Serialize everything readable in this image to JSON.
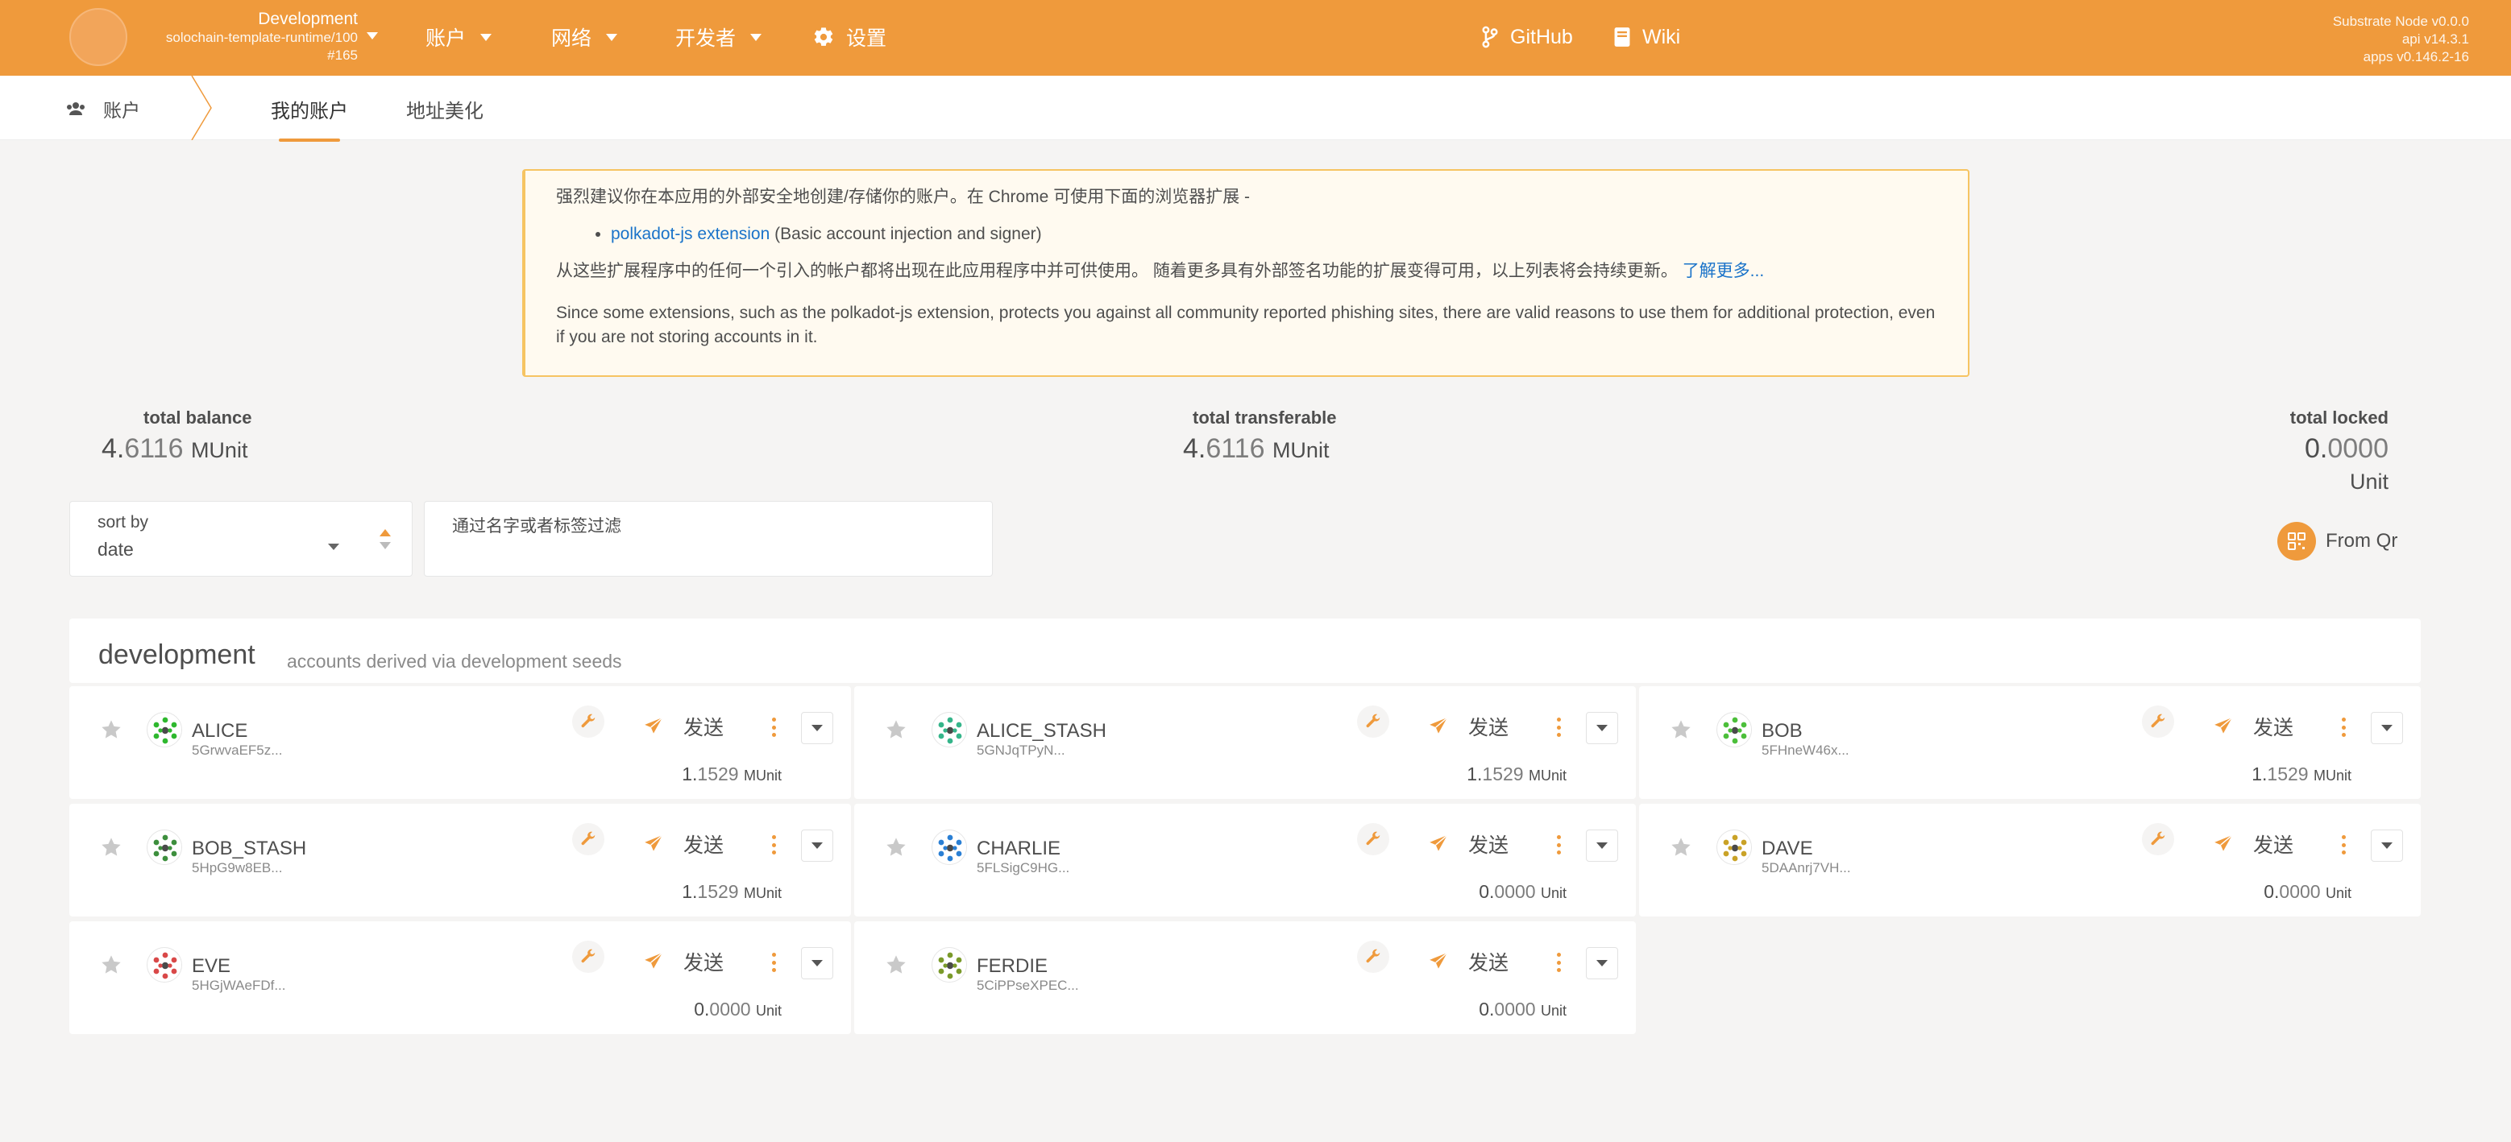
{
  "chain": {
    "name": "Development",
    "runtime": "solochain-template-runtime/100",
    "block": "#165"
  },
  "menu": {
    "accounts": "账户",
    "network": "网络",
    "developer": "开发者",
    "settings": "设置",
    "github": "GitHub",
    "wiki": "Wiki"
  },
  "node_info": {
    "node": "Substrate Node v0.0.0",
    "api": "api v14.3.1",
    "apps": "apps v0.146.2-16"
  },
  "subnav": {
    "section": "账户",
    "tabs": [
      "我的账户",
      "地址美化"
    ]
  },
  "warning": {
    "line1": "强烈建议你在本应用的外部安全地创建/存储你的账户。在 Chrome 可使用下面的浏览器扩展 -",
    "ext_link": "polkadot-js extension",
    "ext_desc": "(Basic account injection and signer)",
    "line2": "从这些扩展程序中的任何一个引入的帐户都将出现在此应用程序中并可供使用。 随着更多具有外部签名功能的扩展变得可用，以上列表将会持续更新。",
    "learn_more": "了解更多...",
    "line3": "Since some extensions, such as the polkadot-js extension, protects you against all community reported phishing sites, there are valid reasons to use them for additional protection, even if you are not storing accounts in it."
  },
  "summary": {
    "total_balance": {
      "label": "total balance",
      "int": "4.",
      "dec": "6116",
      "unit": "MUnit"
    },
    "total_transferable": {
      "label": "total transferable",
      "int": "4.",
      "dec": "6116",
      "unit": "MUnit"
    },
    "total_locked": {
      "label": "total locked",
      "int": "0.",
      "dec": "0000",
      "unit": "Unit"
    }
  },
  "filters": {
    "sort_label": "sort by",
    "sort_value": "date",
    "filter_label": "通过名字或者标签过滤",
    "from_qr": "From Qr"
  },
  "group": {
    "title": "development",
    "subtitle": "accounts derived via development seeds"
  },
  "send_label": "发送",
  "accounts": [
    {
      "name": "ALICE",
      "address": "5GrwvaEF5z...",
      "bal_int": "1.",
      "bal_dec": "1529",
      "unit": "MUnit",
      "color": "#2eb82e"
    },
    {
      "name": "ALICE_STASH",
      "address": "5GNJqTPyN...",
      "bal_int": "1.",
      "bal_dec": "1529",
      "unit": "MUnit",
      "color": "#35b58a"
    },
    {
      "name": "BOB",
      "address": "5FHneW46x...",
      "bal_int": "1.",
      "bal_dec": "1529",
      "unit": "MUnit",
      "color": "#4cbf3a"
    },
    {
      "name": "BOB_STASH",
      "address": "5HpG9w8EB...",
      "bal_int": "1.",
      "bal_dec": "1529",
      "unit": "MUnit",
      "color": "#3d8f3d"
    },
    {
      "name": "CHARLIE",
      "address": "5FLSigC9HG...",
      "bal_int": "0.",
      "bal_dec": "0000",
      "unit": "Unit",
      "color": "#2a7fd4"
    },
    {
      "name": "DAVE",
      "address": "5DAAnrj7VH...",
      "bal_int": "0.",
      "bal_dec": "0000",
      "unit": "Unit",
      "color": "#c9a227"
    },
    {
      "name": "EVE",
      "address": "5HGjWAeFDf...",
      "bal_int": "0.",
      "bal_dec": "0000",
      "unit": "Unit",
      "color": "#d94848"
    },
    {
      "name": "FERDIE",
      "address": "5CiPPseXPEC...",
      "bal_int": "0.",
      "bal_dec": "0000",
      "unit": "Unit",
      "color": "#7a9a2a"
    }
  ],
  "colors": {
    "accent": "#ef9a3c",
    "link": "#1a73c9",
    "warning_border": "#f6c462"
  }
}
